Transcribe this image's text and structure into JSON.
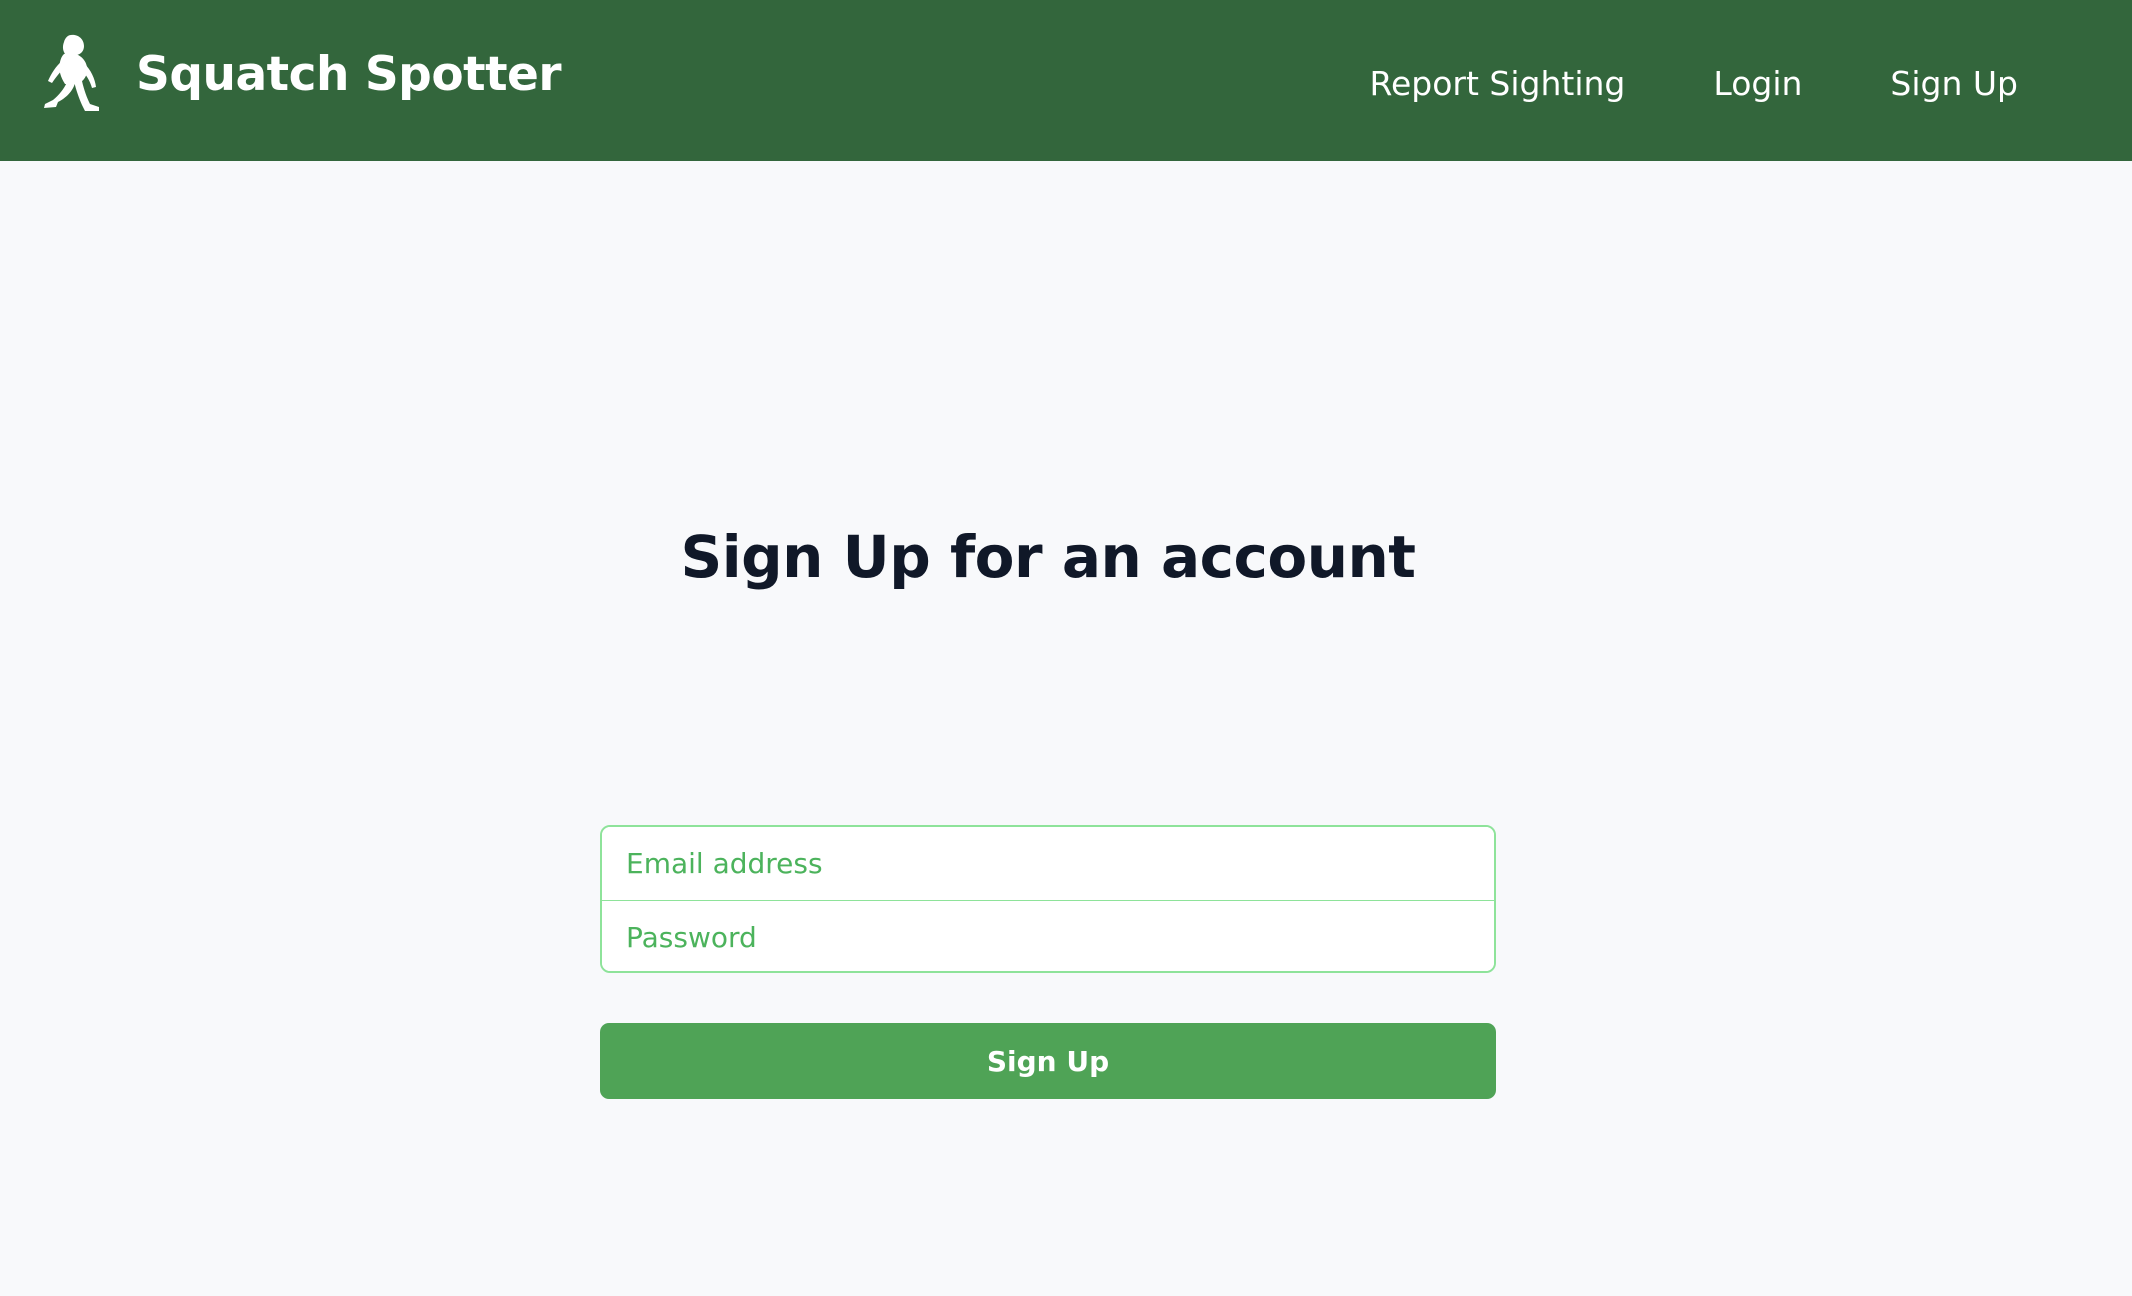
{
  "header": {
    "brand_name": "Squatch Spotter",
    "logo_icon": "bigfoot-icon",
    "nav": {
      "report_sighting": "Report Sighting",
      "login": "Login",
      "sign_up": "Sign Up"
    }
  },
  "form": {
    "title": "Sign Up for an account",
    "email_placeholder": "Email address",
    "password_placeholder": "Password",
    "submit_label": "Sign Up"
  },
  "colors": {
    "header_bg": "#33663c",
    "accent": "#4fa356",
    "input_border": "#8ee39a",
    "placeholder": "#4cb35c",
    "title": "#101828",
    "page_bg": "#f8f9fb"
  }
}
